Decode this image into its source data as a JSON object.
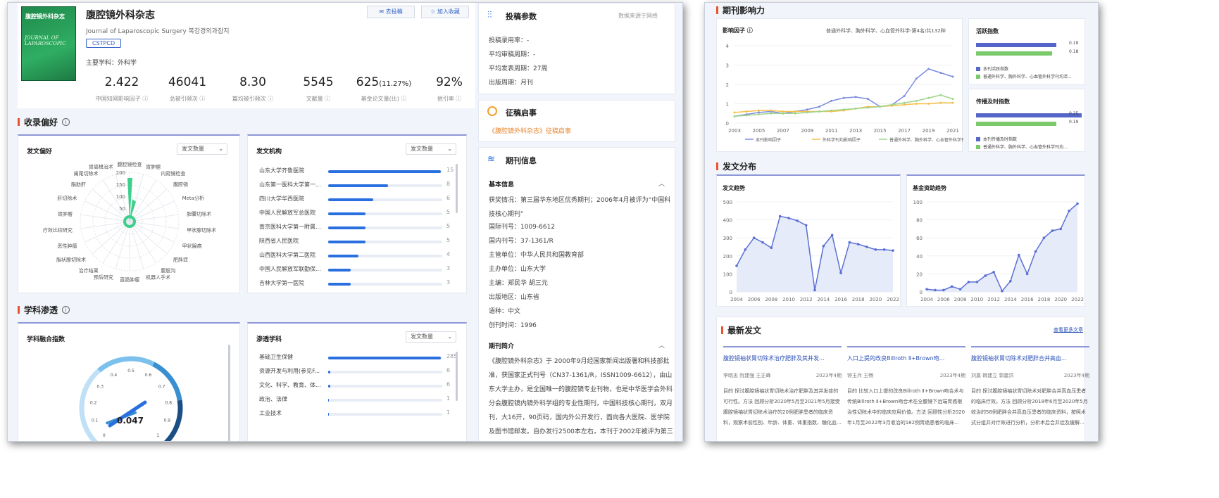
{
  "journal": {
    "title": "腹腔镜外科杂志",
    "english": "Journal of Laparoscopic Surgery 복강경외과잡지",
    "badge": "CSTPCD",
    "subject": "主要学科：外科学",
    "cover_title": "腹腔镜外科杂志",
    "submit_btn": "去投稿",
    "fav_btn": "加入收藏"
  },
  "stats": [
    {
      "value": "2.422",
      "label": "中国知网影响因子 ⓘ"
    },
    {
      "value": "46041",
      "label": "总被引频次 ⓘ"
    },
    {
      "value": "8.30",
      "label": "篇均被引频次 ⓘ"
    },
    {
      "value": "5545",
      "label": "文献量 ⓘ"
    },
    {
      "value": "625",
      "extra": "(11.27%)",
      "label": "基金论文量(比) ⓘ"
    },
    {
      "value": "92%",
      "label": "他引率 ⓘ"
    }
  ],
  "sections": {
    "collect": "收录偏好",
    "discipline": "学科渗透",
    "impact": "期刊影响力",
    "distribution": "发文分布",
    "latest": "最新发文"
  },
  "pref": {
    "title": "发文偏好",
    "dropdown": "发文数量",
    "ticks": [
      "200",
      "150",
      "100",
      "50"
    ],
    "labels": [
      "腹腔镜检查",
      "胃肿瘤",
      "内窥镜检查",
      "腹腔镜",
      "Meta分析",
      "胆囊切除术",
      "甲状腺切除术",
      "甲状腺癌",
      "肥胖症",
      "腹股沟",
      "机器人手术",
      "直肠肿瘤",
      "预后研究",
      "治疗结果",
      "脂状腺切除术",
      "恶性肿瘤",
      "疗效比较研究",
      "胃肿瘤",
      "肝切除术",
      "脂肪肝",
      "阑尾切除术",
      "胃癌根治术"
    ]
  },
  "inst": {
    "title": "发文机构",
    "dropdown": "发文数量",
    "rows": [
      {
        "name": "山东大学齐鲁医院",
        "count": "15",
        "v": 15
      },
      {
        "name": "山东第一医科大学第一...",
        "count": "8",
        "v": 8
      },
      {
        "name": "四川大学华西医院",
        "count": "6",
        "v": 6
      },
      {
        "name": "中国人民解放军总医院",
        "count": "5",
        "v": 5
      },
      {
        "name": "南京医科大学第一附属...",
        "count": "5",
        "v": 5
      },
      {
        "name": "陕西省人民医院",
        "count": "5",
        "v": 5
      },
      {
        "name": "山西医科大学第二医院",
        "count": "4",
        "v": 4
      },
      {
        "name": "中国人民解放军联勤保...",
        "count": "3",
        "v": 3
      },
      {
        "name": "吉林大学第一医院",
        "count": "3",
        "v": 3
      }
    ]
  },
  "fusion": {
    "title": "学科融合指数",
    "value": "0.047",
    "level": 0.047,
    "ticks": [
      "0",
      "0.1",
      "0.2",
      "0.3",
      "0.4",
      "0.5",
      "0.6",
      "0.7",
      "0.8",
      "0.9",
      "1"
    ]
  },
  "pen": {
    "title": "渗透学科",
    "dropdown": "发文数量",
    "rows": [
      {
        "name": "基础卫生保健",
        "count": "285",
        "v": 285
      },
      {
        "name": "资源开发与利用(参见F...",
        "count": "6",
        "v": 6
      },
      {
        "name": "文化、科学、教育、体...",
        "count": "6",
        "v": 6
      },
      {
        "name": "政治、法律",
        "count": "1",
        "v": 1
      },
      {
        "name": "工业技术",
        "count": "1",
        "v": 1
      }
    ]
  },
  "params": {
    "title": "投稿参数",
    "source": "数据来源于网络",
    "items": [
      "投稿录用率：-",
      "平均审稿周期：-",
      "平均发表周期：27周",
      "出版周期：月刊"
    ]
  },
  "notice": {
    "title": "征稿启事",
    "link": "《腹腔镜外科杂志》征稿启事"
  },
  "journal_info": {
    "title": "期刊信息",
    "basic": "基本信息",
    "award": "获奖情况：第三届华东地区优秀期刊；2006年4月被评为“中国科技核心期刊”",
    "items": [
      "国际刊号：1009-6612",
      "国内刊号：37-1361/R",
      "主管单位：中华人民共和国教育部",
      "主办单位：山东大学",
      "主编：郑民华 胡三元",
      "出版地区：山东省",
      "语种：中文",
      "创刊时间：1996"
    ],
    "intro_title": "期刊简介",
    "intro": "《腹腔镜外科杂志》于 2000年9月经国家新闻出版署和科技部批准，获国家正式刊号（CN37-1361/R，ISSN1009-6612），由山东大学主办，是全国唯一的腹腔镜专业刊物，也是中华医学会外科分会腹腔镜内镜外科学组的专业性期刊，中国科技核心期刊，双月刊，大16开，90页码，国内外公开发行，面向各大医院、医学院及图书馆邮发。自办发行2500本左右，本刊于2002年被评为第三届华东地区优秀期刊。并"
  },
  "impact": {
    "title": "影响因子 ⓘ",
    "rank": "普通外科学、胸外科学、心血管外科学-第4名/共132种",
    "legend": [
      "本刊影响因子",
      "外科学刊均影响因子",
      "普通外科学、胸外科学、心血管外科学刊均..."
    ],
    "x_ticks": [
      "2003",
      "2005",
      "2007",
      "2009",
      "2011",
      "2013",
      "2015",
      "2017",
      "2019",
      "2021"
    ],
    "y_ticks": [
      "0",
      "1",
      "2",
      "3",
      "4"
    ],
    "colors": [
      "#7c8ce0",
      "#f5c04a",
      "#9fd48c"
    ]
  },
  "idx1": {
    "title": "活跃指数",
    "v1": "0.19",
    "v2": "0.18",
    "l1": "本刊活跃指数",
    "l2": "普通外科学、胸外科学、心血管外科学刊均活...",
    "n1": 0.19,
    "n2": 0.18
  },
  "idx2": {
    "title": "传播及时指数",
    "v1": "0.25",
    "v2": "0.19",
    "l1": "本刊传播及时指数",
    "l2": "普通外科学、胸外科学、心血管外科学刊均...",
    "n1": 0.25,
    "n2": 0.19
  },
  "trend": {
    "title": "发文趋势",
    "y_ticks": [
      "0",
      "100",
      "200",
      "300",
      "400",
      "500"
    ],
    "x_ticks": [
      "2004",
      "2006",
      "2008",
      "2010",
      "2012",
      "2014",
      "2016",
      "2018",
      "2020",
      "2022"
    ]
  },
  "fund": {
    "title": "基金资助趋势",
    "y_ticks": [
      "0",
      "20",
      "40",
      "60",
      "80",
      "100"
    ],
    "x_ticks": [
      "2004",
      "2006",
      "2008",
      "2010",
      "2012",
      "2014",
      "2016",
      "2018",
      "2020",
      "2022"
    ]
  },
  "latest_more": "查看更多文章",
  "articles": [
    {
      "title": "腹腔镜袖状胃切除术治疗肥胖及其并发...",
      "authors": "李晓忠 阮建强 王正峰",
      "date": "2023年4期",
      "body": "目的 探讨腹腔镜袖状胃切除术治疗肥胖及其并发症的可行性。方法 回顾分析2020年5月至2021年5月接受腹腔镜袖状胃切除术治疗的20例肥胖患者的临床资料，观察术前性别、年龄、体重、体重指数、糖化血..."
    },
    {
      "title": "入口上提的改良Billroth Ⅱ+Brown吻...",
      "authors": "钟玉兵 王畅",
      "date": "2023年4期",
      "body": "目的 比较入口上提的改良Billroth Ⅱ+Brown吻合术与传统Billroth Ⅱ+Brown吻合术在全腹镜下远端胃癌根治性切除术中的临床应用价值。方法 回顾性分析2020年1月至2022年3月收治的182例胃癌患者的临床..."
    },
    {
      "title": "腹腔镜袖状胃切除术对肥胖合并高血...",
      "authors": "刘嘉 韩建立 郭震洪",
      "date": "2023年4期",
      "body": "目的 探讨腹腔镜袖状胃切除术对肥胖合并高血压患者的临床疗效。方法 回顾分析2018年6月至2020年5月收治的58例肥胖合并高血压患者的临床资料，按照术式分组并对疗效进行分析，分析术后合并症及缓解..."
    }
  ],
  "chart_data": [
    {
      "type": "line",
      "title": "影响因子",
      "x": [
        2003,
        2004,
        2005,
        2006,
        2007,
        2008,
        2009,
        2010,
        2011,
        2012,
        2013,
        2014,
        2015,
        2016,
        2017,
        2018,
        2019,
        2020,
        2021
      ],
      "series": [
        {
          "name": "本刊影响因子",
          "values": [
            0.35,
            0.45,
            0.55,
            0.6,
            0.5,
            0.6,
            0.7,
            0.85,
            1.15,
            1.3,
            1.35,
            1.25,
            0.85,
            0.95,
            1.4,
            2.3,
            2.8,
            2.6,
            2.4
          ]
        },
        {
          "name": "外科学刊均影响因子",
          "values": [
            0.55,
            0.6,
            0.65,
            0.65,
            0.6,
            0.6,
            0.6,
            0.6,
            0.6,
            0.65,
            0.75,
            0.85,
            0.85,
            0.9,
            0.95,
            1.0,
            1.0,
            1.05,
            1.05
          ]
        },
        {
          "name": "普通外科学、胸外科学、心血管外科学刊均...",
          "values": [
            0.35,
            0.4,
            0.45,
            0.5,
            0.5,
            0.5,
            0.55,
            0.6,
            0.65,
            0.7,
            0.75,
            0.8,
            0.85,
            0.95,
            1.05,
            1.15,
            1.3,
            1.45,
            1.25
          ]
        }
      ],
      "ylim": [
        0,
        4
      ]
    },
    {
      "type": "area",
      "title": "发文趋势",
      "x": [
        2004,
        2005,
        2006,
        2007,
        2008,
        2009,
        2010,
        2011,
        2012,
        2013,
        2014,
        2015,
        2016,
        2017,
        2018,
        2019,
        2020,
        2021,
        2022
      ],
      "values": [
        145,
        235,
        300,
        275,
        245,
        420,
        410,
        395,
        370,
        10,
        255,
        315,
        105,
        275,
        265,
        250,
        235,
        235,
        230
      ],
      "ylim": [
        0,
        500
      ]
    },
    {
      "type": "area",
      "title": "基金资助趋势",
      "x": [
        2004,
        2005,
        2006,
        2007,
        2008,
        2009,
        2010,
        2011,
        2012,
        2013,
        2014,
        2015,
        2016,
        2017,
        2018,
        2019,
        2020,
        2021,
        2022
      ],
      "values": [
        3,
        2,
        2,
        6,
        3,
        11,
        11,
        18,
        22,
        1,
        12,
        41,
        20,
        45,
        60,
        68,
        70,
        90,
        98
      ],
      "ylim": [
        0,
        100
      ]
    }
  ]
}
